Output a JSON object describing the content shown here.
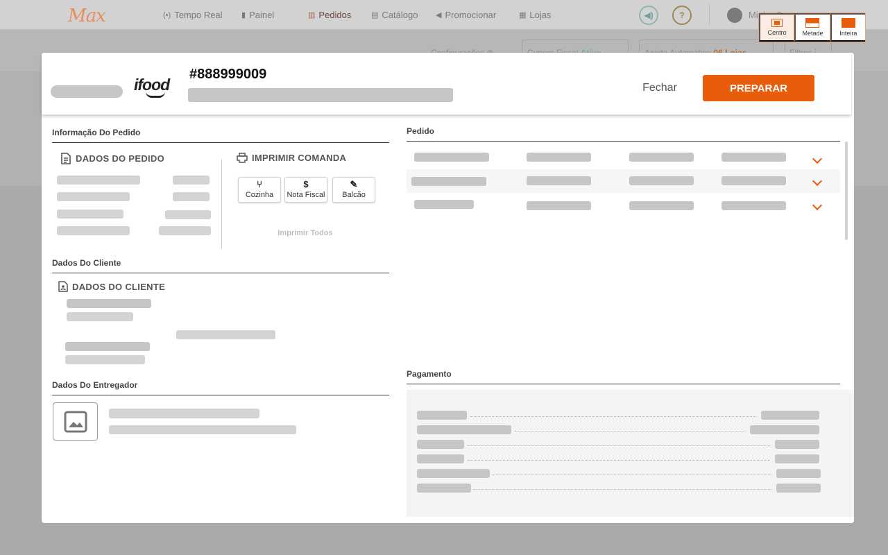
{
  "nav": {
    "logo": "Max",
    "items": [
      {
        "label": "Tempo Real",
        "icon": "radio-icon"
      },
      {
        "label": "Painel",
        "icon": "bar-chart-icon"
      },
      {
        "label": "Pedidos",
        "icon": "list-icon"
      },
      {
        "label": "Catálogo",
        "icon": "book-icon"
      },
      {
        "label": "Promocionar",
        "icon": "megaphone-icon"
      },
      {
        "label": "Lojas",
        "icon": "store-icon"
      }
    ],
    "user_name": "Minha Conta"
  },
  "subbar": {
    "config": "Configurações",
    "cupom": "Cupom Fiscal",
    "cupom_status": "Ativo",
    "aceite": "Aceite Automático",
    "aceite_value": "06 Lojas",
    "filtros": "Filtros"
  },
  "layout_switcher": {
    "options": [
      "Centro",
      "Metade",
      "Inteira"
    ]
  },
  "modal": {
    "brand": "ifood",
    "order_number": "#888999009",
    "close_label": "Fechar",
    "prepare_label": "PREPARAR",
    "accent": "#e85d0c"
  },
  "sections": {
    "order_info": "Informação Do Pedido",
    "order_data": "DADOS DO PEDIDO",
    "print_ticket": "IMPRIMIR COMANDA",
    "print_buttons": [
      {
        "label": "Cozinha",
        "icon": "fork-knife-icon"
      },
      {
        "label": "Nota Fiscal",
        "icon": "dollar-icon"
      },
      {
        "label": "Balcão",
        "icon": "pencil-icon"
      }
    ],
    "print_all": "Imprimir Todos",
    "client": "Dados Do Cliente",
    "client_data": "DADOS DO CLIENTE",
    "courier": "Dados Do Entregador",
    "order": "Pedido",
    "payment": "Pagamento"
  }
}
